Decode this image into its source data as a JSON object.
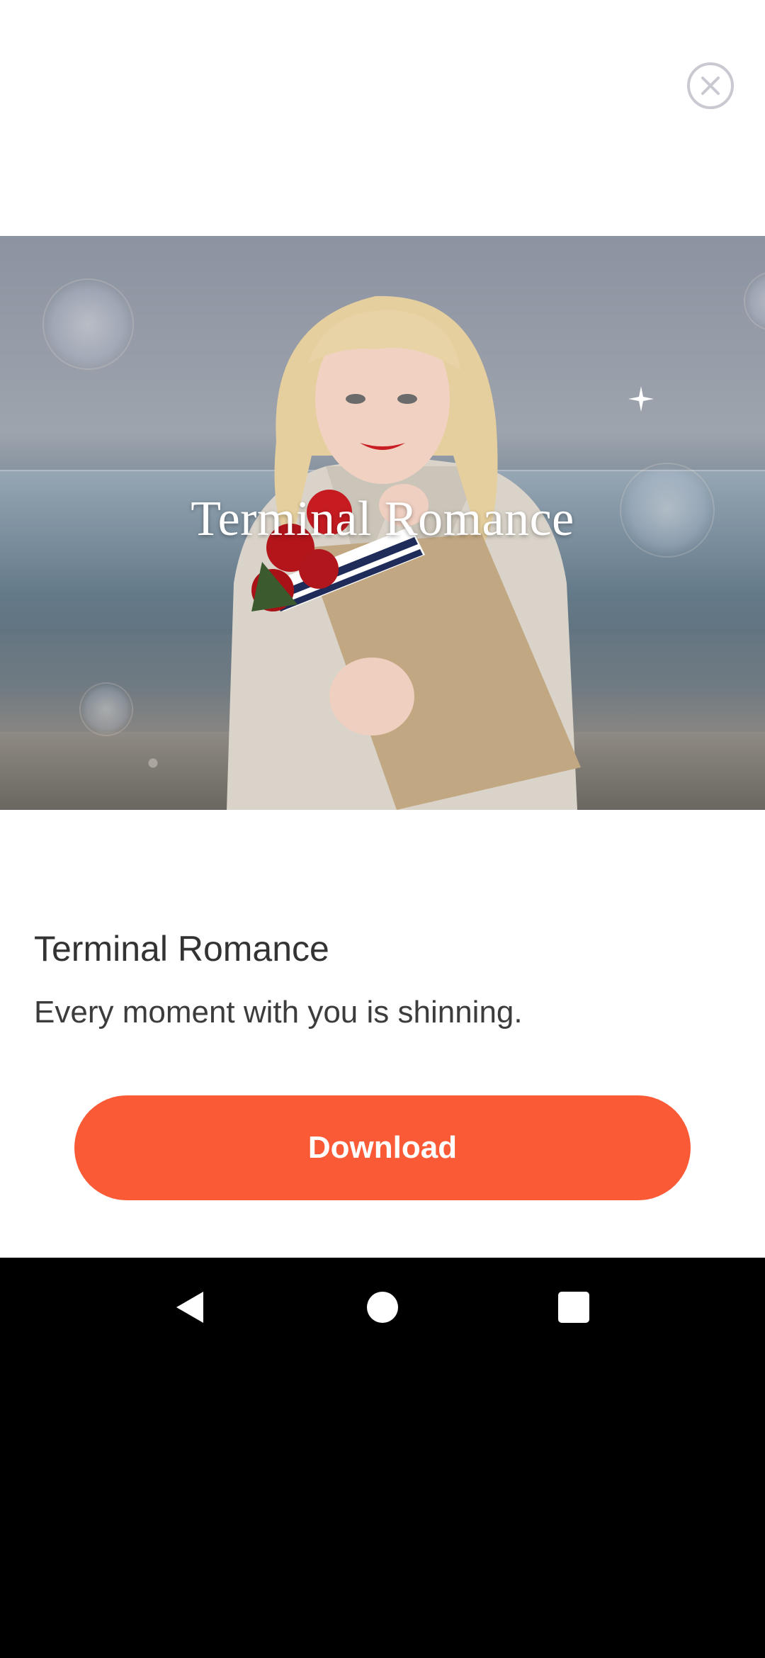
{
  "dialog": {
    "close_icon": "close-icon"
  },
  "banner": {
    "title": "Terminal Romance"
  },
  "content": {
    "title": "Terminal Romance",
    "subtitle": "Every moment with you is shinning."
  },
  "actions": {
    "download_label": "Download",
    "download_color": "#fa5a35"
  },
  "nav": {
    "back_icon": "back-triangle-icon",
    "home_icon": "home-circle-icon",
    "recents_icon": "recents-square-icon"
  }
}
